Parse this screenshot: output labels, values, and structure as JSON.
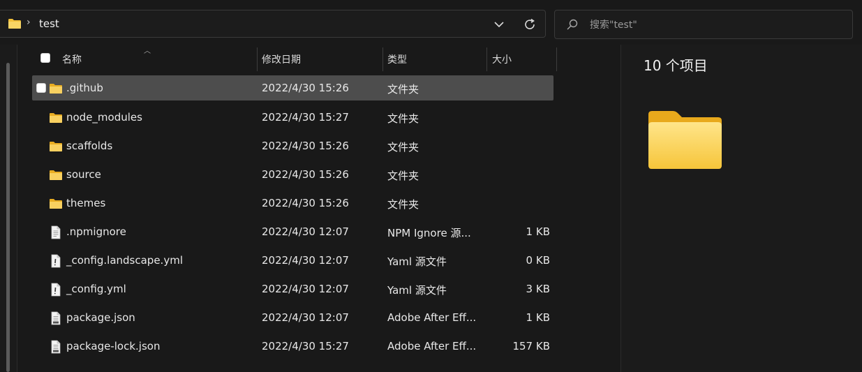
{
  "address": {
    "separator": "›",
    "path": "test"
  },
  "search": {
    "placeholder": "搜索\"test\""
  },
  "columns": {
    "name": "名称",
    "modified": "修改日期",
    "type": "类型",
    "size": "大小"
  },
  "files": [
    {
      "name": ".github",
      "modified": "2022/4/30 15:26",
      "type": "文件夹",
      "size": "",
      "icon": "folder-icon",
      "selected": true
    },
    {
      "name": "node_modules",
      "modified": "2022/4/30 15:27",
      "type": "文件夹",
      "size": "",
      "icon": "folder-icon"
    },
    {
      "name": "scaffolds",
      "modified": "2022/4/30 15:26",
      "type": "文件夹",
      "size": "",
      "icon": "folder-icon"
    },
    {
      "name": "source",
      "modified": "2022/4/30 15:26",
      "type": "文件夹",
      "size": "",
      "icon": "folder-icon"
    },
    {
      "name": "themes",
      "modified": "2022/4/30 15:26",
      "type": "文件夹",
      "size": "",
      "icon": "folder-icon"
    },
    {
      "name": ".npmignore",
      "modified": "2022/4/30 12:07",
      "type": "NPM Ignore 源...",
      "size": "1 KB",
      "icon": "text-file-icon"
    },
    {
      "name": "_config.landscape.yml",
      "modified": "2022/4/30 12:07",
      "type": "Yaml 源文件",
      "size": "0 KB",
      "icon": "yaml-file-icon"
    },
    {
      "name": "_config.yml",
      "modified": "2022/4/30 12:07",
      "type": "Yaml 源文件",
      "size": "3 KB",
      "icon": "yaml-file-icon"
    },
    {
      "name": "package.json",
      "modified": "2022/4/30 12:07",
      "type": "Adobe After Eff...",
      "size": "1 KB",
      "icon": "json-file-icon"
    },
    {
      "name": "package-lock.json",
      "modified": "2022/4/30 15:27",
      "type": "Adobe After Eff...",
      "size": "157 KB",
      "icon": "json-file-icon"
    }
  ],
  "details": {
    "item_count": "10 个项目"
  },
  "colors": {
    "folder": "#f3c13a",
    "background": "#191919",
    "selected_row": "#4d4d4d"
  }
}
